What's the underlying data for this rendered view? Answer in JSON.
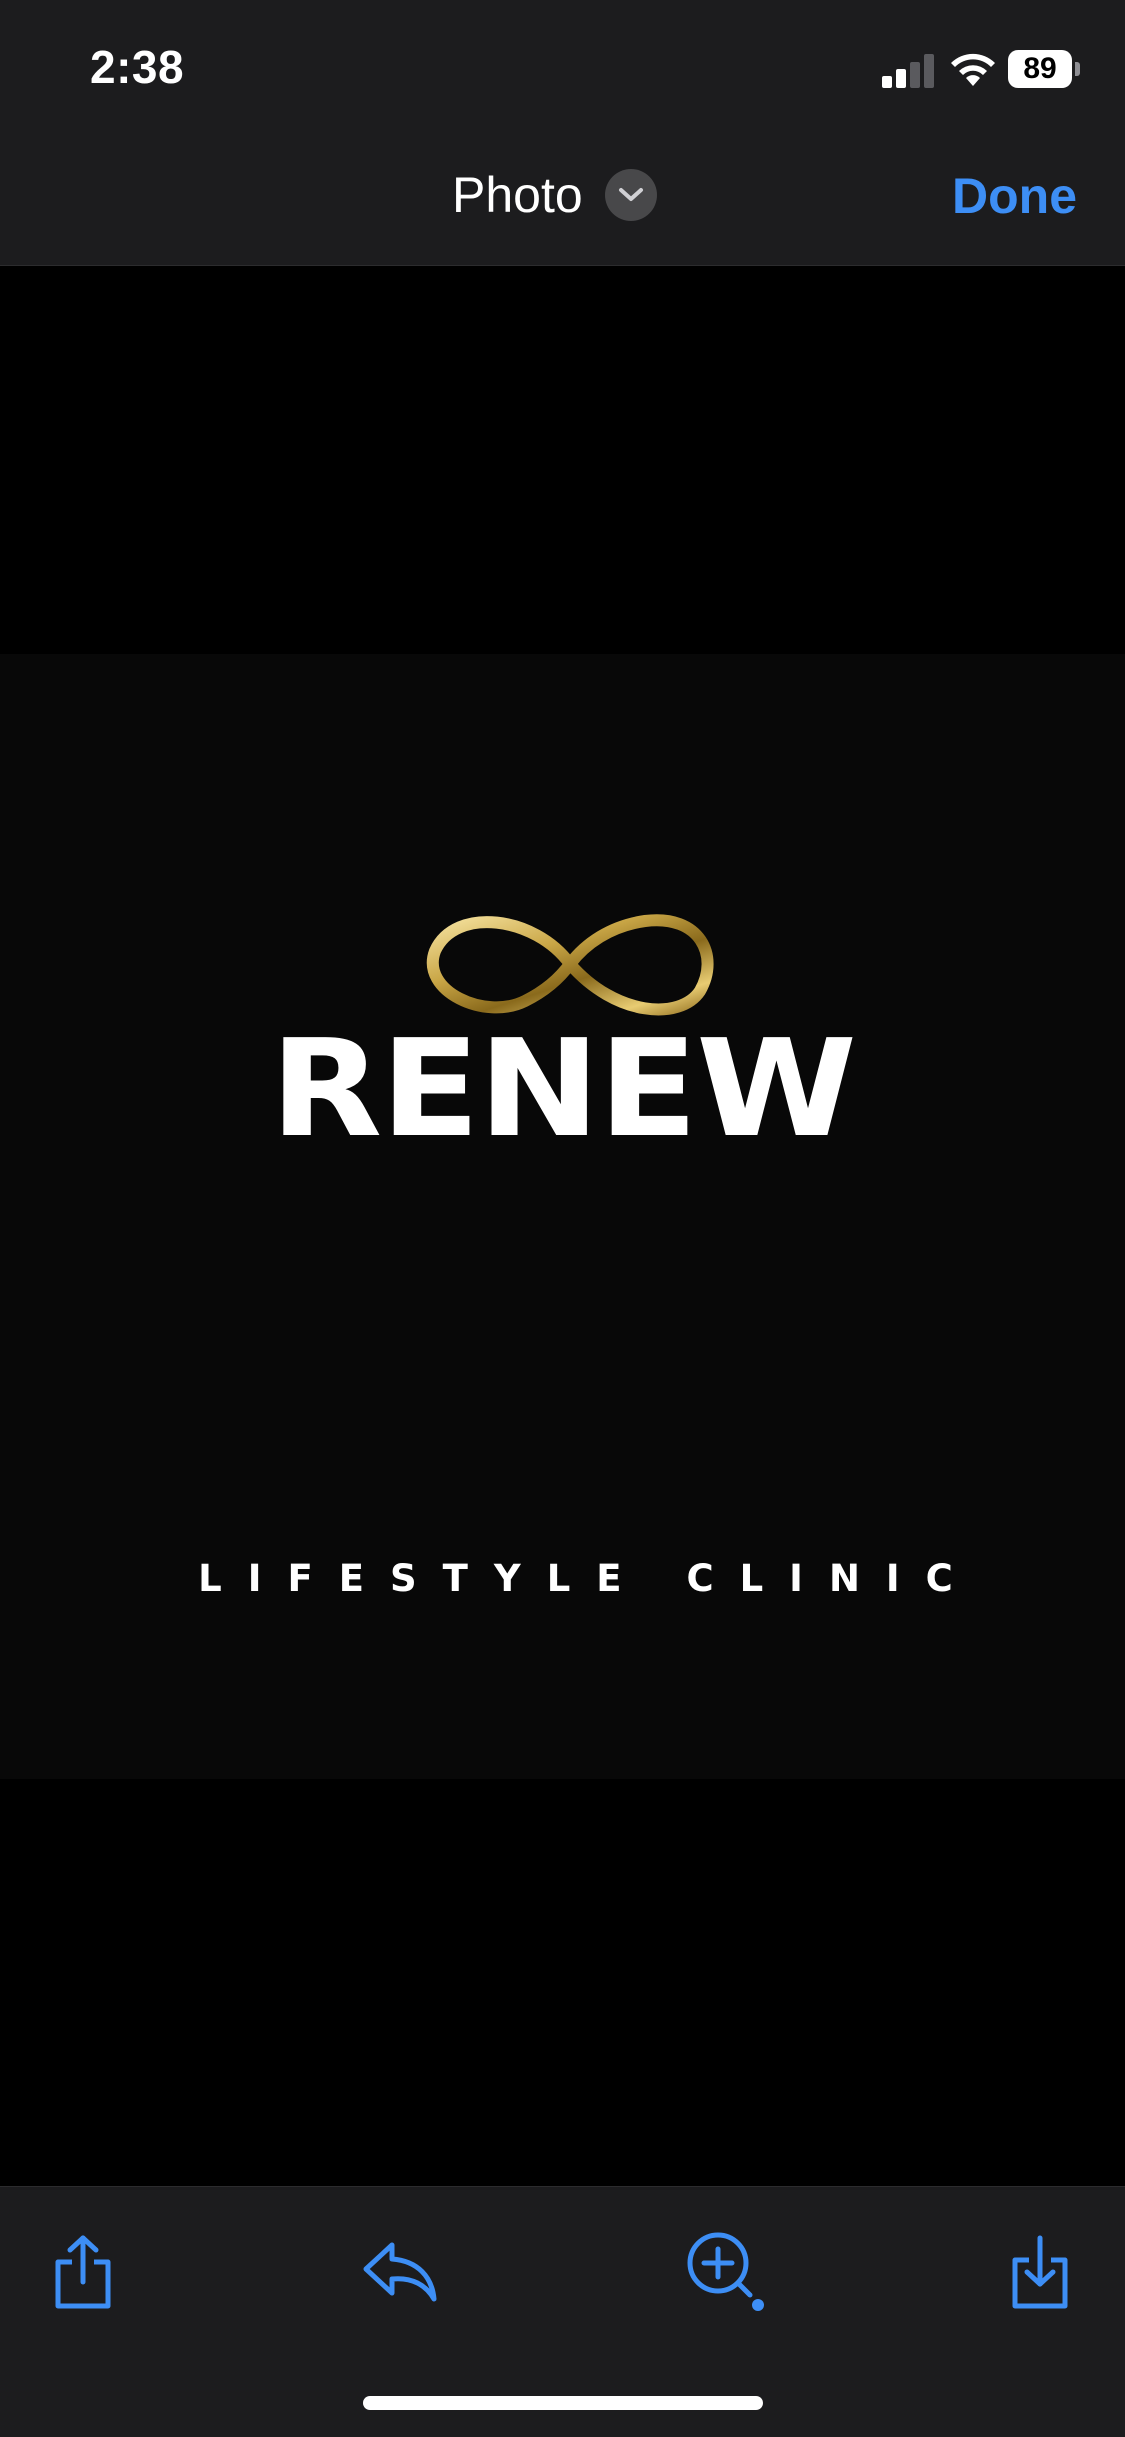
{
  "status_bar": {
    "time": "2:38",
    "battery_level": "89",
    "signal_bars_active": 2,
    "signal_bars_total": 4
  },
  "nav": {
    "title": "Photo",
    "done_label": "Done"
  },
  "photo": {
    "logo": {
      "wordmark": "RENEW",
      "tagline": "LIFESTYLE CLINIC"
    }
  },
  "toolbar": {
    "buttons": [
      "share-icon",
      "reply-icon",
      "markup-zoom-icon",
      "save-icon"
    ]
  },
  "colors": {
    "accent": "#3d8ef5",
    "bar_background": "#1c1c1e",
    "logo_gold": "#c9a646"
  }
}
